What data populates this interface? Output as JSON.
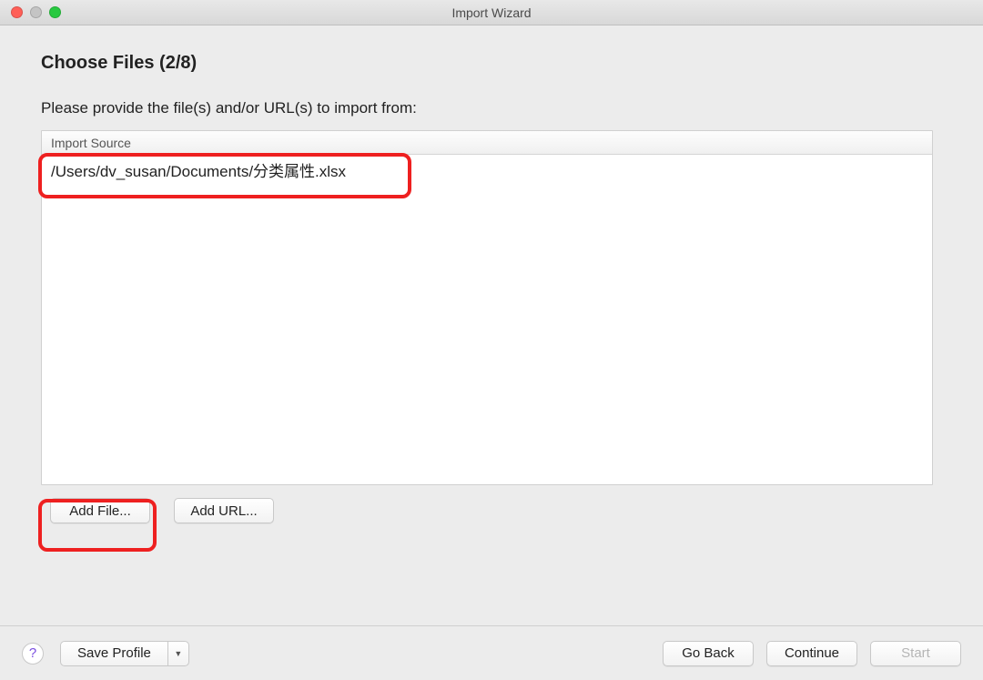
{
  "window": {
    "title": "Import Wizard"
  },
  "step": {
    "title": "Choose Files (2/8)",
    "instruction": "Please provide the file(s) and/or URL(s) to import from:"
  },
  "table": {
    "header": "Import Source",
    "rows": [
      "/Users/dv_susan/Documents/分类属性.xlsx"
    ]
  },
  "buttons": {
    "add_file": "Add File...",
    "add_url": "Add URL...",
    "help": "?",
    "save_profile": "Save Profile",
    "go_back": "Go Back",
    "continue": "Continue",
    "start": "Start"
  }
}
